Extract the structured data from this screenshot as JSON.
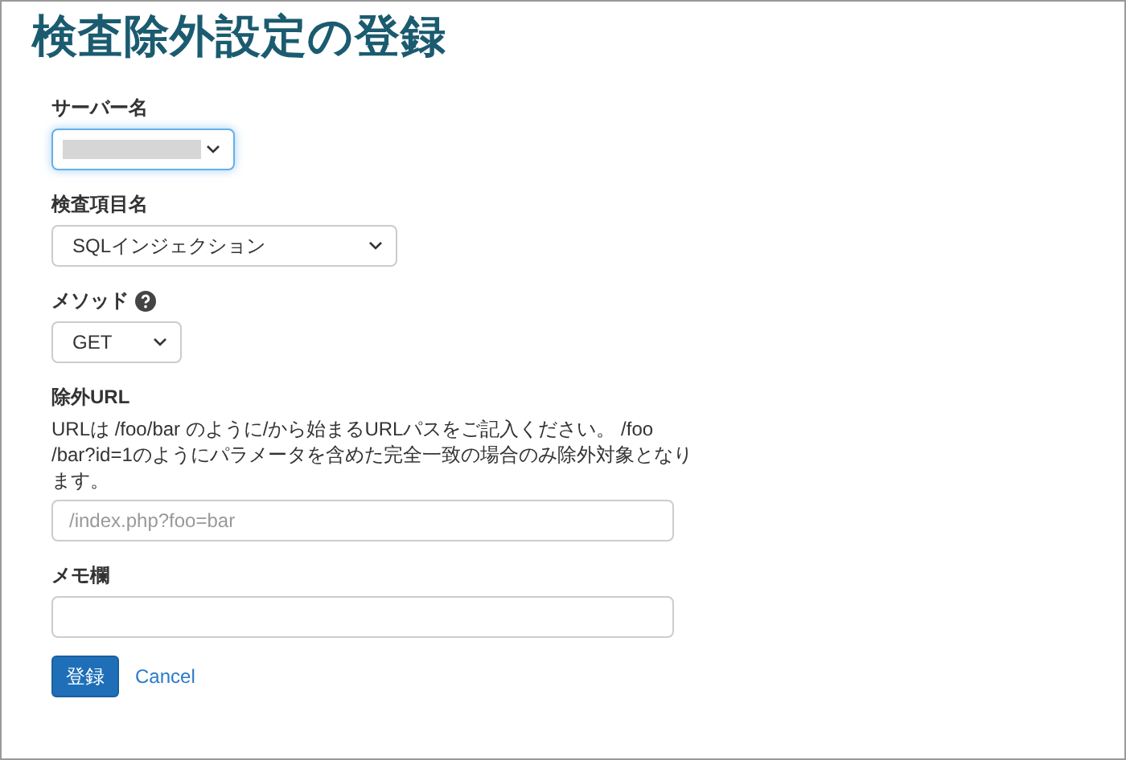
{
  "title": "検査除外設定の登録",
  "fields": [
    {
      "kind": "select",
      "label": "サーバー名",
      "redacted": true,
      "focused": true
    },
    {
      "kind": "select",
      "label": "検査項目名",
      "value": "SQLインジェクション",
      "focused": false
    },
    {
      "kind": "select",
      "label": "メソッド",
      "help_icon": true,
      "value": "GET",
      "focused": false
    },
    {
      "kind": "text",
      "label": "除外URL",
      "description": "URLは /foo/bar のように/から始まるURLパスをご記入ください。 /foo /bar?id=1のようにパラメータを含めた完全一致の場合のみ除外対象となります。",
      "placeholder": "/index.php?foo=bar",
      "focused": false
    },
    {
      "kind": "text",
      "label": "メモ欄",
      "focused": false
    }
  ],
  "submit": "登録",
  "cancel": "Cancel"
}
